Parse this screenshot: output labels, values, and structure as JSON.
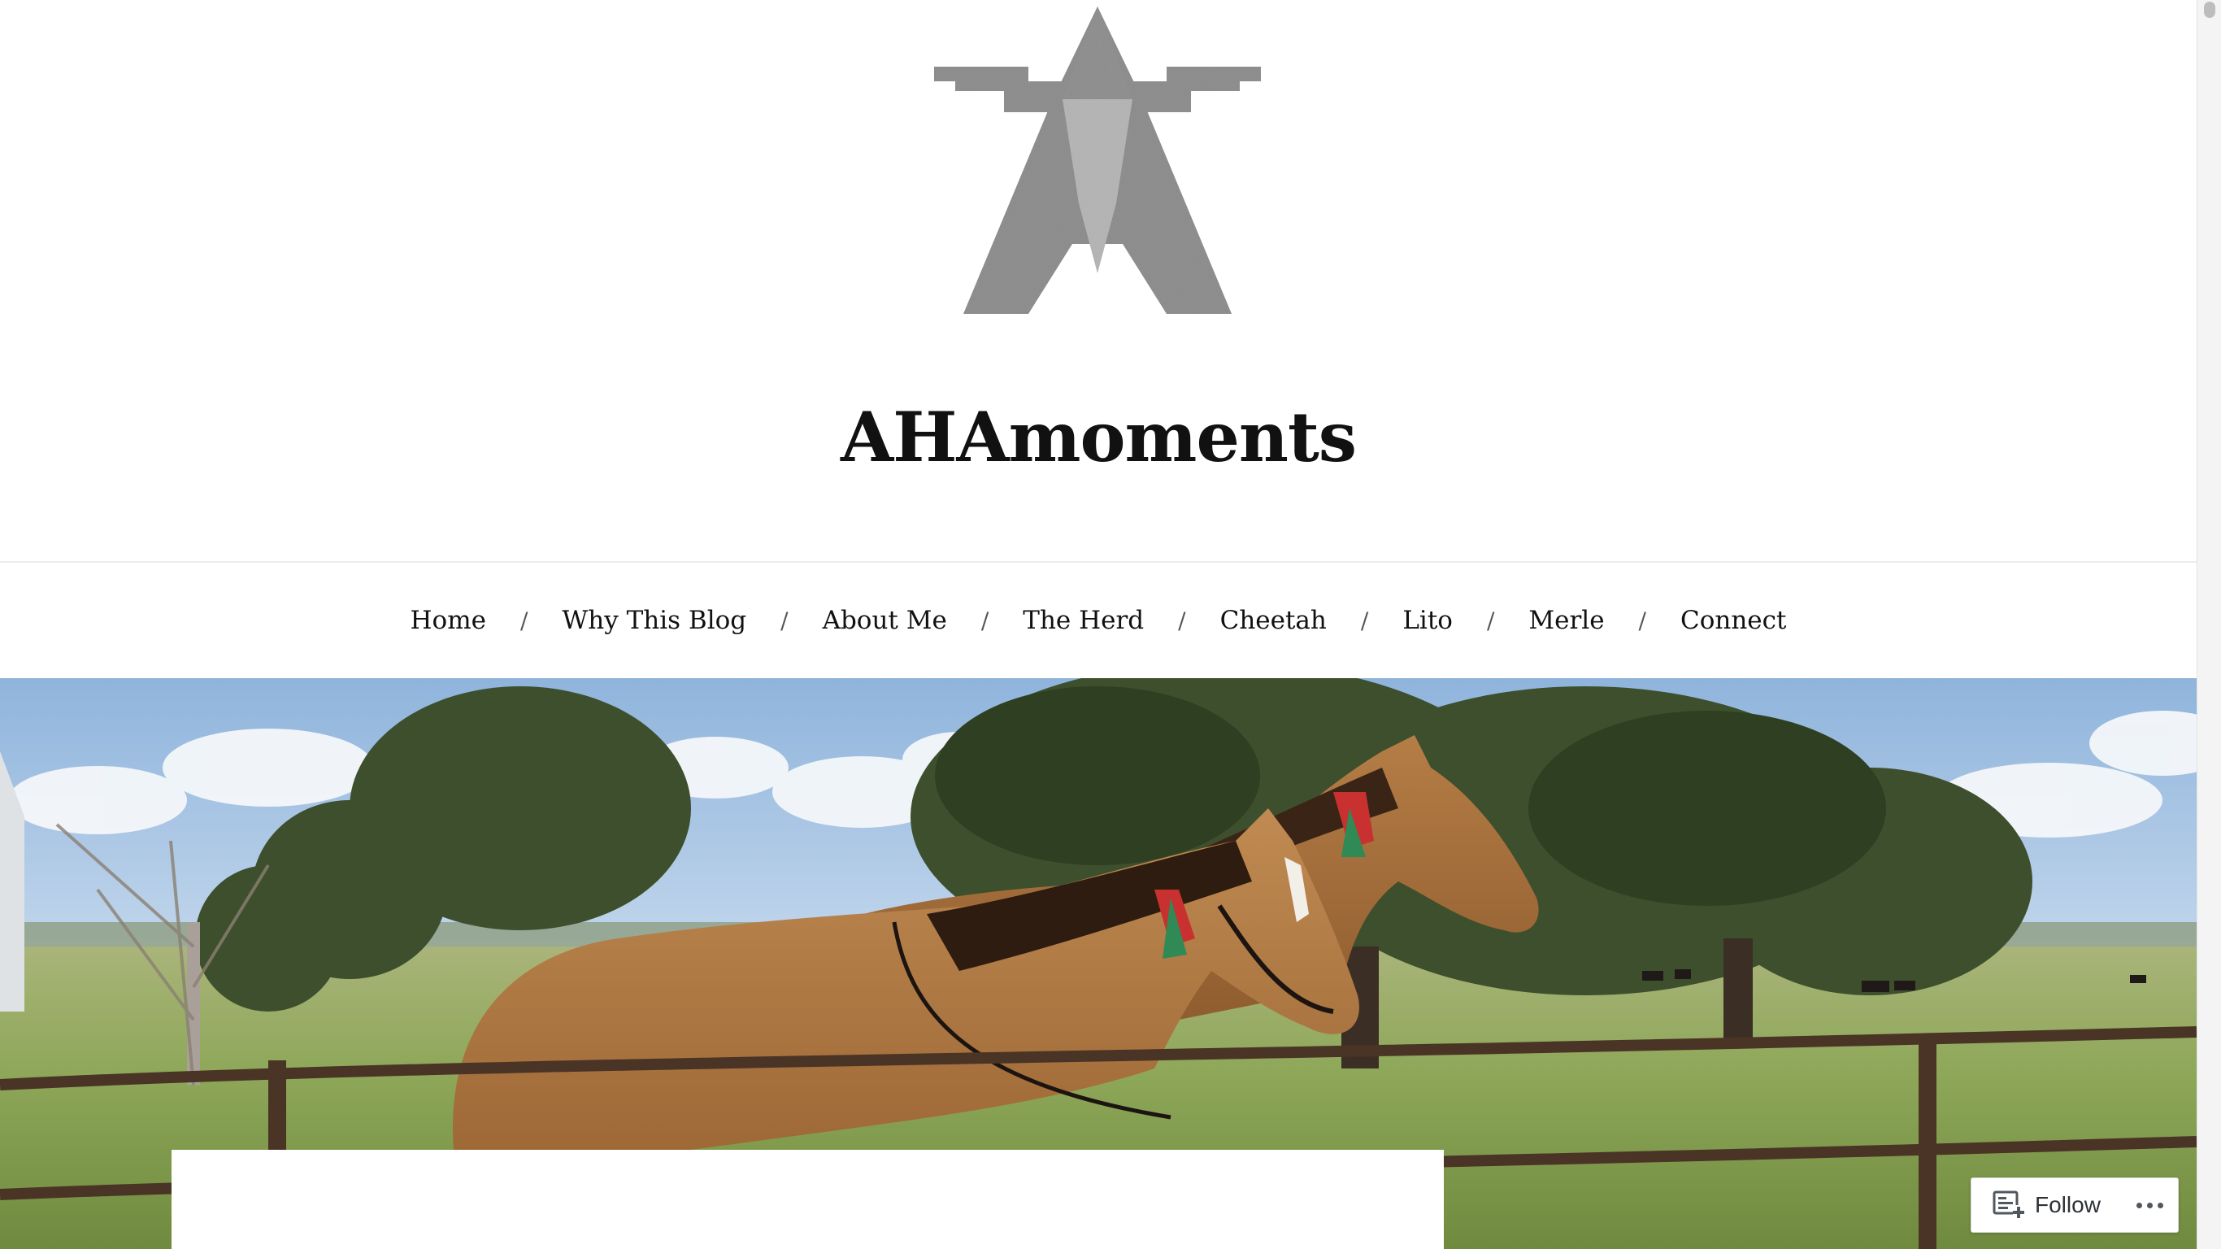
{
  "site": {
    "title": "AHAmoments",
    "logo_icon": "aha-logo-icon"
  },
  "nav": {
    "items": [
      {
        "label": "Home"
      },
      {
        "label": "Why This Blog"
      },
      {
        "label": "About Me"
      },
      {
        "label": "The Herd"
      },
      {
        "label": "Cheetah"
      },
      {
        "label": "Lito"
      },
      {
        "label": "Merle"
      },
      {
        "label": "Connect"
      }
    ],
    "separator": "/"
  },
  "hero": {
    "image": "header-image-two-horses-pasture"
  },
  "follow": {
    "label": "Follow",
    "icon": "reader-follow-icon",
    "more_icon": "ellipsis-icon"
  },
  "colors": {
    "text": "#111111",
    "logo_gray": "#888888",
    "logo_light": "#b3b3b3",
    "follow_text": "#2c3338"
  }
}
